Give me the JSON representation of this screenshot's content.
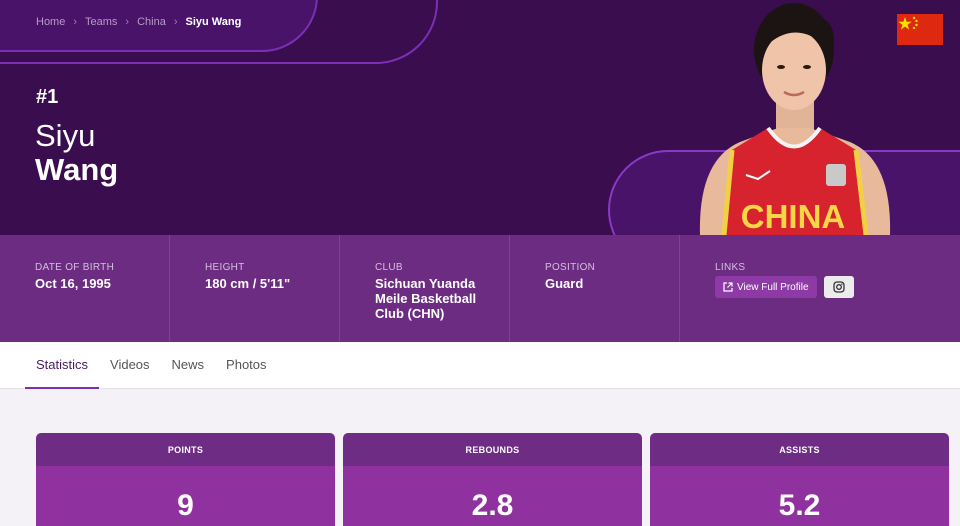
{
  "breadcrumb": [
    {
      "label": "Home"
    },
    {
      "label": "Teams"
    },
    {
      "label": "China"
    },
    {
      "label": "Siyu Wang"
    }
  ],
  "player": {
    "number": "#1",
    "first_name": "Siyu",
    "last_name": "Wang",
    "jersey_text": "CHINA"
  },
  "info": {
    "dob": {
      "label": "DATE OF BIRTH",
      "value": "Oct 16, 1995"
    },
    "height": {
      "label": "HEIGHT",
      "value": "180 cm / 5'11\""
    },
    "club": {
      "label": "CLUB",
      "value": "Sichuan Yuanda Meile Basketball Club (CHN)"
    },
    "position": {
      "label": "POSITION",
      "value": "Guard"
    },
    "links": {
      "label": "LINKS",
      "profile_button": "View Full Profile"
    }
  },
  "tabs": [
    {
      "label": "Statistics",
      "active": true
    },
    {
      "label": "Videos"
    },
    {
      "label": "News"
    },
    {
      "label": "Photos"
    }
  ],
  "stats": [
    {
      "label": "POINTS",
      "value": "9"
    },
    {
      "label": "REBOUNDS",
      "value": "2.8"
    },
    {
      "label": "ASSISTS",
      "value": "5.2"
    }
  ],
  "colors": {
    "hero_bg": "#3a0d4f",
    "accent": "#7b2fb3",
    "infobar_bg": "#6b2c81",
    "stat_head": "#6e2c85",
    "stat_body": "#8f319f",
    "flag_red": "#de2910",
    "flag_star": "#ffde00"
  },
  "icons": [
    "chevron-right-icon",
    "external-link-icon",
    "instagram-icon",
    "china-flag-icon"
  ]
}
